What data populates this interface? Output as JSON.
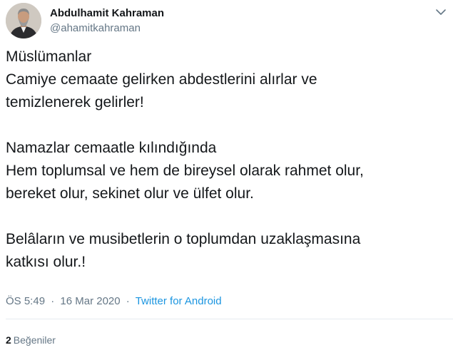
{
  "author": {
    "name": "Abdulhamit Kahraman",
    "handle": "@ahamitkahraman"
  },
  "icons": {
    "avatar": "profile-photo",
    "more": "chevron-down-icon"
  },
  "tweet": {
    "lines": [
      "Müslümanlar",
      "Camiye cemaate gelirken abdestlerini alırlar ve",
      "temizlenerek gelirler!",
      "",
      "Namazlar cemaatle kılındığında",
      "Hem toplumsal ve hem de bireysel olarak rahmet olur,",
      "bereket olur, sekinet olur ve ülfet olur.",
      "",
      "Belâların ve musibetlerin o toplumdan uzaklaşmasına",
      "katkısı olur.!"
    ]
  },
  "meta": {
    "time": "ÖS 5:49",
    "separator": "·",
    "date": "16 Mar 2020",
    "source": "Twitter for Android"
  },
  "stats": {
    "likes_count": "2",
    "likes_label": "Beğeniler"
  },
  "colors": {
    "text": "#14171a",
    "secondary": "#657786",
    "link": "#1b95e0",
    "divider": "#e6ecf0"
  }
}
